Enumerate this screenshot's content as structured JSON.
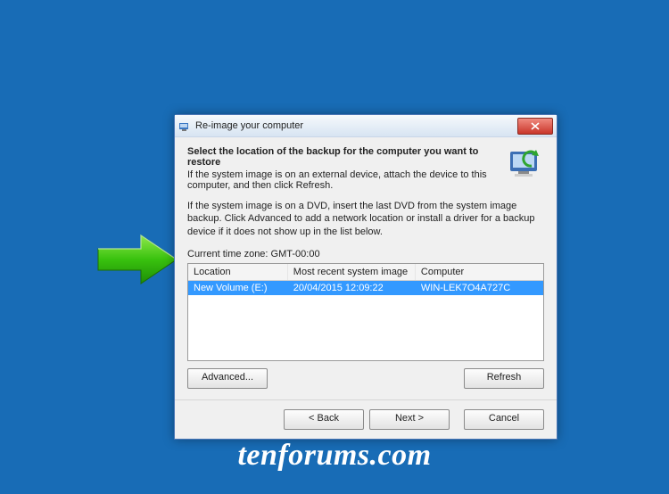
{
  "watermark": "tenforums.com",
  "dialog": {
    "title": "Re-image your computer",
    "heading": "Select the location of the backup for the computer you want to restore",
    "heading_sub": "If the system image is on an external device, attach the device to this computer, and then click Refresh.",
    "dvd_note": "If the system image is on a DVD, insert the last DVD from the system image backup. Click Advanced to add a network location or install a driver for a backup device if it does not show up in the list below.",
    "timezone_label": "Current time zone: GMT-00:00",
    "columns": {
      "c0": "Location",
      "c1": "Most recent system image",
      "c2": "Computer"
    },
    "rows": [
      {
        "location": "New Volume (E:)",
        "image": "20/04/2015 12:09:22",
        "computer": "WIN-LEK7O4A727C"
      }
    ],
    "buttons": {
      "advanced": "Advanced...",
      "refresh": "Refresh",
      "back": "< Back",
      "next": "Next >",
      "cancel": "Cancel"
    }
  }
}
